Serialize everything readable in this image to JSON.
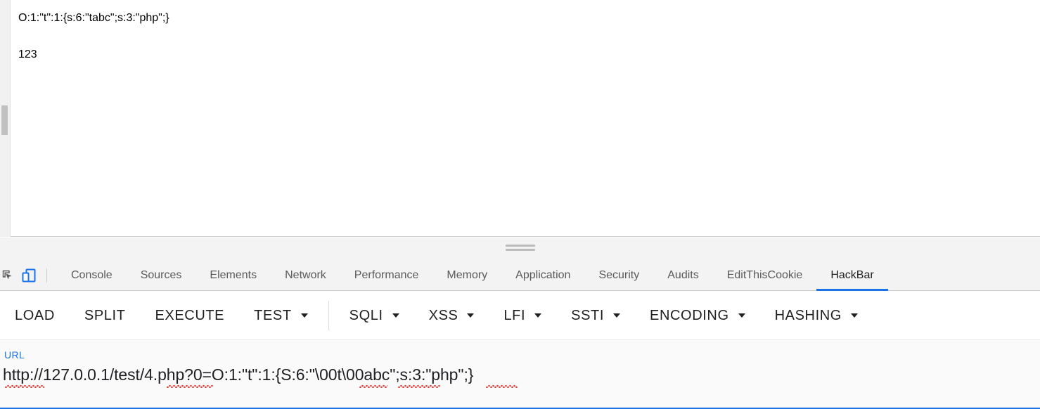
{
  "page": {
    "output_lines": [
      "O:1:\"t\":1:{s:6:\"tabc\";s:3:\"php\";}",
      "123"
    ]
  },
  "devtools": {
    "icons": [
      {
        "name": "inspect-element-icon",
        "label": "Inspect element"
      },
      {
        "name": "device-toolbar-icon",
        "label": "Toggle device toolbar"
      }
    ],
    "tabs": [
      {
        "label": "Console",
        "active": false
      },
      {
        "label": "Sources",
        "active": false
      },
      {
        "label": "Elements",
        "active": false
      },
      {
        "label": "Network",
        "active": false
      },
      {
        "label": "Performance",
        "active": false
      },
      {
        "label": "Memory",
        "active": false
      },
      {
        "label": "Application",
        "active": false
      },
      {
        "label": "Security",
        "active": false
      },
      {
        "label": "Audits",
        "active": false
      },
      {
        "label": "EditThisCookie",
        "active": false
      },
      {
        "label": "HackBar",
        "active": true
      }
    ],
    "active_tab": "HackBar",
    "accent_color": "#1a73e8"
  },
  "hackbar": {
    "buttons": [
      {
        "label": "LOAD",
        "dropdown": false
      },
      {
        "label": "SPLIT",
        "dropdown": false
      },
      {
        "label": "EXECUTE",
        "dropdown": false
      },
      {
        "label": "TEST",
        "dropdown": true
      },
      {
        "label": "SQLI",
        "dropdown": true
      },
      {
        "label": "XSS",
        "dropdown": true
      },
      {
        "label": "LFI",
        "dropdown": true
      },
      {
        "label": "SSTI",
        "dropdown": true
      },
      {
        "label": "ENCODING",
        "dropdown": true
      },
      {
        "label": "HASHING",
        "dropdown": true
      }
    ],
    "url": {
      "label": "URL",
      "value": "http://127.0.0.1/test/4.php?0=O:1:\"t\":1:{S:6:\"\\00t\\00abc\";s:3:\"php\";}",
      "placeholder": "URL",
      "focused": true
    }
  }
}
